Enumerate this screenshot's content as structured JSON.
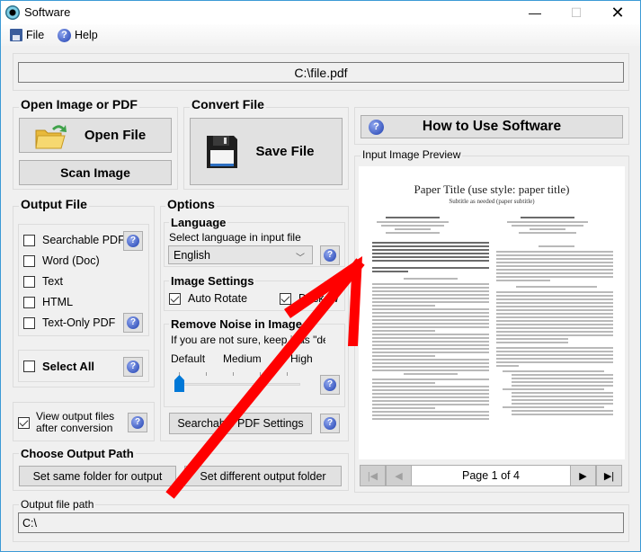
{
  "window": {
    "title": "Software",
    "controls": {
      "minimize": "—",
      "maximize": "☐",
      "close": "✕"
    }
  },
  "menu": {
    "items": [
      {
        "label": "File",
        "icon": "floppy-disk-icon"
      },
      {
        "label": "Help",
        "icon": "help-icon"
      }
    ]
  },
  "input_path": {
    "value": "C:\\file.pdf"
  },
  "open_group": {
    "title": "Open Image or PDF",
    "open_file_label": "Open File",
    "scan_image_label": "Scan Image"
  },
  "convert_group": {
    "title": "Convert File",
    "save_file_label": "Save File"
  },
  "how_to": {
    "label": "How to Use Software"
  },
  "output_file": {
    "title": "Output File",
    "options": [
      {
        "label": "Searchable PDF",
        "checked": false,
        "help": true
      },
      {
        "label": "Word (Doc)",
        "checked": false,
        "help": false
      },
      {
        "label": "Text",
        "checked": false,
        "help": false
      },
      {
        "label": "HTML",
        "checked": false,
        "help": false
      },
      {
        "label": "Text-Only PDF",
        "checked": false,
        "help": true
      }
    ],
    "select_all": {
      "label": "Select All",
      "checked": false
    },
    "view_after": {
      "label_line1": "View output files",
      "label_line2": "after conversion",
      "checked": true
    }
  },
  "options": {
    "title": "Options",
    "language": {
      "title": "Language",
      "hint": "Select language in input file",
      "selected": "English"
    },
    "image_settings": {
      "title": "Image Settings",
      "auto_rotate": {
        "label": "Auto Rotate",
        "checked": true
      },
      "deskew": {
        "label": "Deskew",
        "checked": true
      }
    },
    "noise": {
      "title": "Remove Noise in Image",
      "hint": "If you are not sure, keep it as \"default\"",
      "levels": [
        "Default",
        "Medium",
        "High"
      ],
      "value_index": 0,
      "tick_count": 5
    },
    "searchable_pdf_settings_label": "Searchable PDF Settings"
  },
  "output_path": {
    "title": "Choose Output Path",
    "same_folder_label": "Set same folder for output",
    "different_folder_label": "Set different output folder",
    "file_path_title": "Output file path",
    "file_path_value": "C:\\"
  },
  "preview": {
    "title": "Input Image Preview",
    "doc_title": "Paper Title (use style: paper title)",
    "doc_subtitle": "Subtitle as needed (paper subtitle)",
    "page_label": "Page 1 of 4",
    "nav": {
      "first": "|◀",
      "prev": "◀",
      "next": "▶",
      "last": "▶|"
    }
  },
  "annotation": {
    "type": "red-arrow",
    "color": "#ff0000"
  }
}
